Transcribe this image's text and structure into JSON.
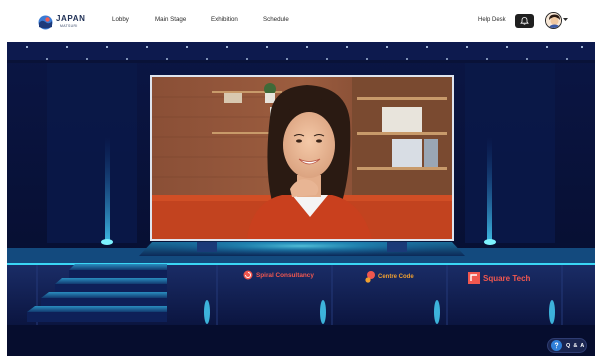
{
  "brand": {
    "name": "JAPAN",
    "tagline": "MATSURI"
  },
  "nav": {
    "items": [
      {
        "label": "Lobby"
      },
      {
        "label": "Main Stage"
      },
      {
        "label": "Exhibition"
      },
      {
        "label": "Schedule"
      }
    ]
  },
  "header": {
    "help_desk": "Help Desk",
    "notifications_icon": "bell-icon",
    "profile_icon": "avatar"
  },
  "stage": {
    "sponsors": [
      {
        "name": "Spiral Consultancy",
        "color": "#f0574f"
      },
      {
        "name": "Centre Code",
        "color": "#f0a02f"
      },
      {
        "name": "Square Tech",
        "color": "#f0574f"
      }
    ]
  },
  "qa": {
    "label": "Q & A"
  },
  "colors": {
    "stage_bg": "#08123a",
    "accent_glow": "#34d4f0",
    "header_bg": "#ffffff"
  }
}
